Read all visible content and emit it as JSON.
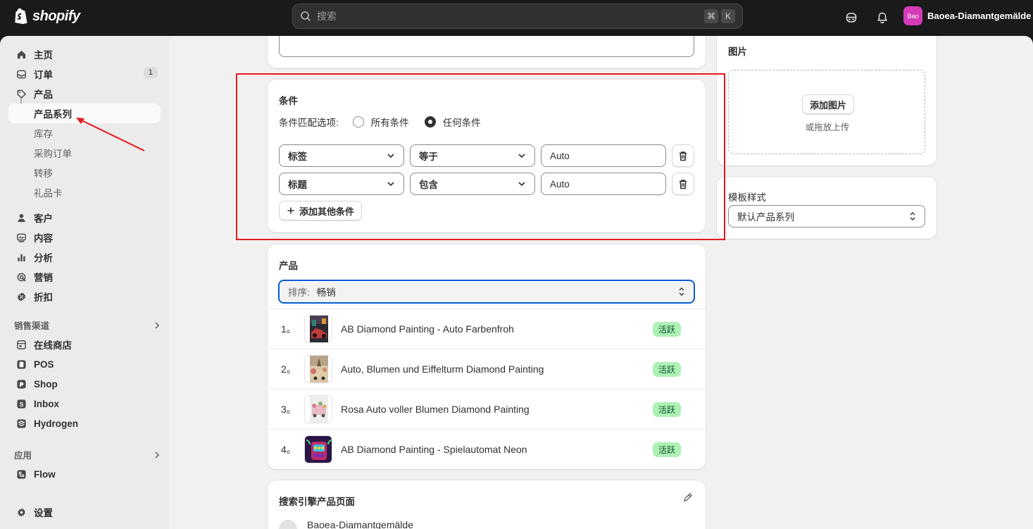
{
  "topbar": {
    "logo_text": "shopify",
    "search_placeholder": "搜索",
    "shortcut_keys": [
      "⌘",
      "K"
    ],
    "store_avatar": "Bao",
    "store_name": "Baoea-Diamantgemälde"
  },
  "sidebar": {
    "items": [
      {
        "label": "主页",
        "icon": "home-icon"
      },
      {
        "label": "订单",
        "icon": "inbox-icon",
        "badge": "1"
      },
      {
        "label": "产品",
        "icon": "tag-icon"
      },
      {
        "label": "产品系列"
      },
      {
        "label": "库存"
      },
      {
        "label": "采购订单"
      },
      {
        "label": "转移"
      },
      {
        "label": "礼品卡"
      },
      {
        "label": "客户",
        "icon": "person-icon"
      },
      {
        "label": "内容",
        "icon": "content-icon"
      },
      {
        "label": "分析",
        "icon": "chart-icon"
      },
      {
        "label": "营销",
        "icon": "target-icon"
      },
      {
        "label": "折扣",
        "icon": "discount-icon"
      }
    ],
    "sales_channels_heading": "销售渠道",
    "channels": [
      {
        "label": "在线商店",
        "icon": "store-icon"
      },
      {
        "label": "POS",
        "icon": "pos-icon"
      },
      {
        "label": "Shop",
        "icon": "shop-icon"
      },
      {
        "label": "Inbox",
        "icon": "inbox-app-icon"
      },
      {
        "label": "Hydrogen",
        "icon": "hydrogen-icon"
      }
    ],
    "apps_heading": "应用",
    "apps": [
      {
        "label": "Flow",
        "icon": "flow-icon"
      }
    ],
    "settings_label": "设置"
  },
  "conditions": {
    "title": "条件",
    "match_label": "条件匹配选项:",
    "options": [
      "所有条件",
      "任何条件"
    ],
    "selected_option": "任何条件",
    "rows": [
      {
        "field": "标签",
        "operator": "等于",
        "value": "Auto"
      },
      {
        "field": "标题",
        "operator": "包含",
        "value": "Auto"
      }
    ],
    "add_button": "添加其他条件"
  },
  "products": {
    "title": "产品",
    "sort_label": "排序:",
    "sort_value": "畅销",
    "items": [
      {
        "index": "1。",
        "name": "AB Diamond Painting - Auto Farbenfroh",
        "status": "活跃"
      },
      {
        "index": "2。",
        "name": "Auto, Blumen und Eiffelturm Diamond Painting",
        "status": "活跃"
      },
      {
        "index": "3。",
        "name": "Rosa Auto voller Blumen Diamond Painting",
        "status": "活跃"
      },
      {
        "index": "4。",
        "name": "AB Diamond Painting - Spielautomat Neon",
        "status": "活跃"
      }
    ]
  },
  "seo": {
    "title": "搜索引擎产品页面",
    "store_name": "Baoea-Diamantgemälde"
  },
  "image_card": {
    "title": "图片",
    "add_button": "添加图片",
    "hint": "或拖放上传"
  },
  "template_card": {
    "label": "模板样式",
    "value": "默认产品系列"
  },
  "colors": {
    "accent": "#005bd3",
    "annotation": "#e5191f",
    "badge_active_bg": "#aff0b5",
    "store_avatar": "#d63ab8"
  }
}
